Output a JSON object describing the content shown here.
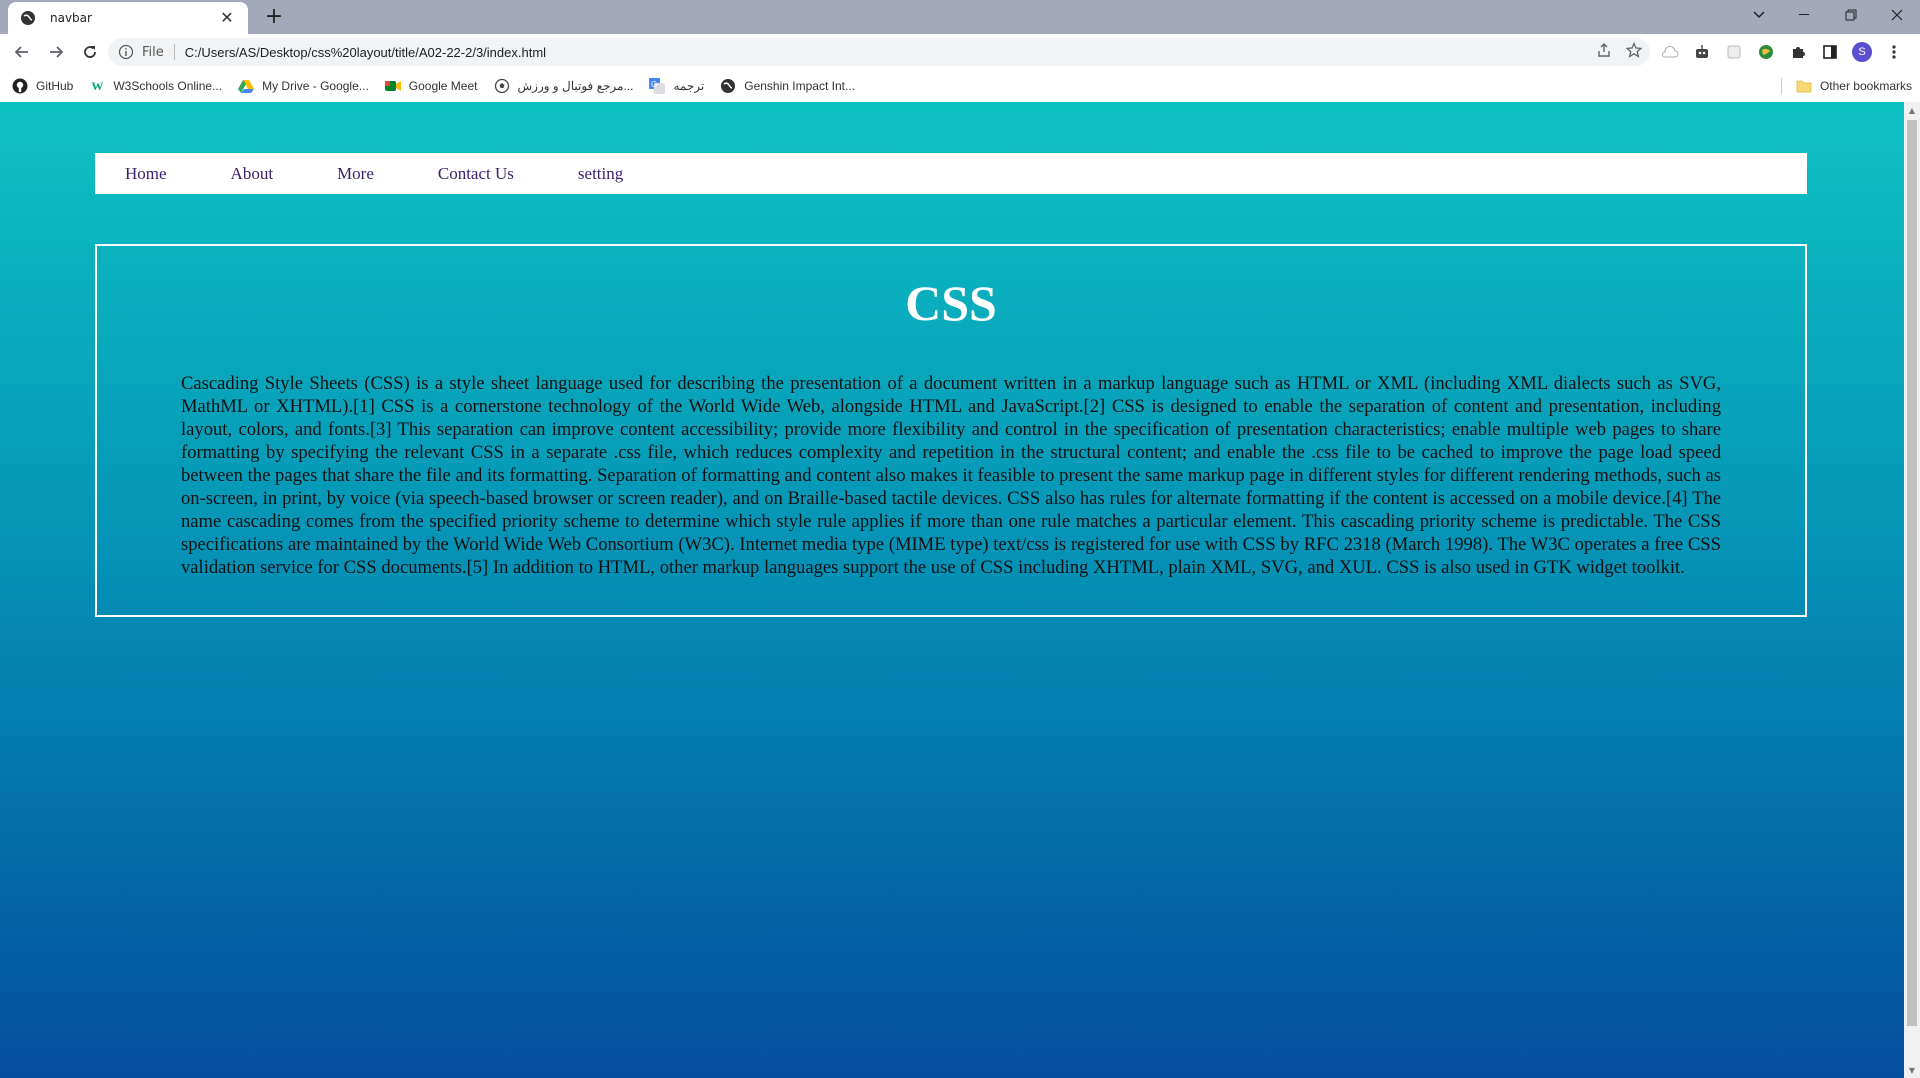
{
  "browser": {
    "tab": {
      "title": "navbar"
    },
    "omnibox": {
      "scheme": "File",
      "url": "C:/Users/AS/Desktop/css%20layout/title/A02-22-2/3/index.html"
    },
    "profile_initial": "S",
    "bookmarks": [
      {
        "label": "GitHub",
        "icon": "github-icon"
      },
      {
        "label": "W3Schools Online...",
        "icon": "w3schools-icon"
      },
      {
        "label": "My Drive - Google...",
        "icon": "google-drive-icon"
      },
      {
        "label": "Google Meet",
        "icon": "google-meet-icon"
      },
      {
        "label": "مرجع فوتبال و ورزش...",
        "icon": "football-icon"
      },
      {
        "label": "ترجمه",
        "icon": "translate-icon"
      },
      {
        "label": "Genshin Impact Int...",
        "icon": "globe-icon"
      }
    ],
    "other_bookmarks": "Other bookmarks"
  },
  "page": {
    "nav": [
      "Home",
      "About",
      "More",
      "Contact Us",
      "setting"
    ],
    "title": "CSS",
    "body": "Cascading Style Sheets (CSS) is a style sheet language used for describing the presentation of a document written in a markup language such as HTML or XML (including XML dialects such as SVG, MathML or XHTML).[1] CSS is a cornerstone technology of the World Wide Web, alongside HTML and JavaScript.[2] CSS is designed to enable the separation of content and presentation, including layout, colors, and fonts.[3] This separation can improve content accessibility; provide more flexibility and control in the specification of presentation characteristics; enable multiple web pages to share formatting by specifying the relevant CSS in a separate .css file, which reduces complexity and repetition in the structural content; and enable the .css file to be cached to improve the page load speed between the pages that share the file and its formatting. Separation of formatting and content also makes it feasible to present the same markup page in different styles for different rendering methods, such as on-screen, in print, by voice (via speech-based browser or screen reader), and on Braille-based tactile devices. CSS also has rules for alternate formatting if the content is accessed on a mobile device.[4] The name cascading comes from the specified priority scheme to determine which style rule applies if more than one rule matches a particular element. This cascading priority scheme is predictable. The CSS specifications are maintained by the World Wide Web Consortium (W3C). Internet media type (MIME type) text/css is registered for use with CSS by RFC 2318 (March 1998). The W3C operates a free CSS validation service for CSS documents.[5] In addition to HTML, other markup languages support the use of CSS including XHTML, plain XML, SVG, and XUL. CSS is also used in GTK widget toolkit."
  },
  "colors": {
    "gradient_top": "#0ec2c2",
    "gradient_bottom": "#044e9e",
    "nav_link": "#3a1f6e",
    "title": "#ffffff"
  }
}
